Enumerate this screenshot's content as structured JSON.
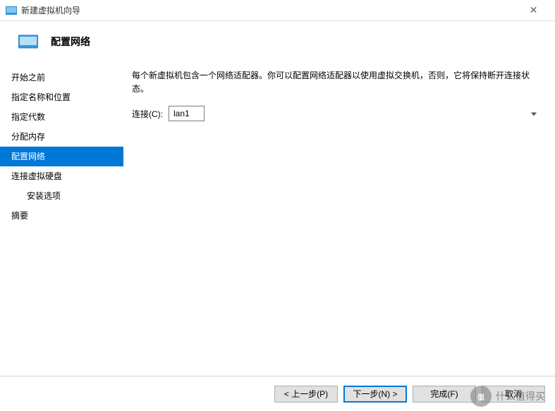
{
  "window": {
    "title": "新建虚拟机向导"
  },
  "header": {
    "title": "配置网络"
  },
  "sidebar": {
    "items": [
      {
        "label": "开始之前",
        "active": false,
        "indented": false
      },
      {
        "label": "指定名称和位置",
        "active": false,
        "indented": false
      },
      {
        "label": "指定代数",
        "active": false,
        "indented": false
      },
      {
        "label": "分配内存",
        "active": false,
        "indented": false
      },
      {
        "label": "配置网络",
        "active": true,
        "indented": false
      },
      {
        "label": "连接虚拟硬盘",
        "active": false,
        "indented": false
      },
      {
        "label": "安装选项",
        "active": false,
        "indented": true
      },
      {
        "label": "摘要",
        "active": false,
        "indented": false
      }
    ]
  },
  "main": {
    "description": "每个新虚拟机包含一个网络适配器。你可以配置网络适配器以使用虚拟交换机，否则，它将保持断开连接状态。",
    "connection_label": "连接(C):",
    "connection_value": "lan1"
  },
  "footer": {
    "prev": "< 上一步(P)",
    "next": "下一步(N) >",
    "finish": "完成(F)",
    "cancel": "取消"
  },
  "watermark": {
    "badge": "值",
    "text": "什么值得买"
  }
}
